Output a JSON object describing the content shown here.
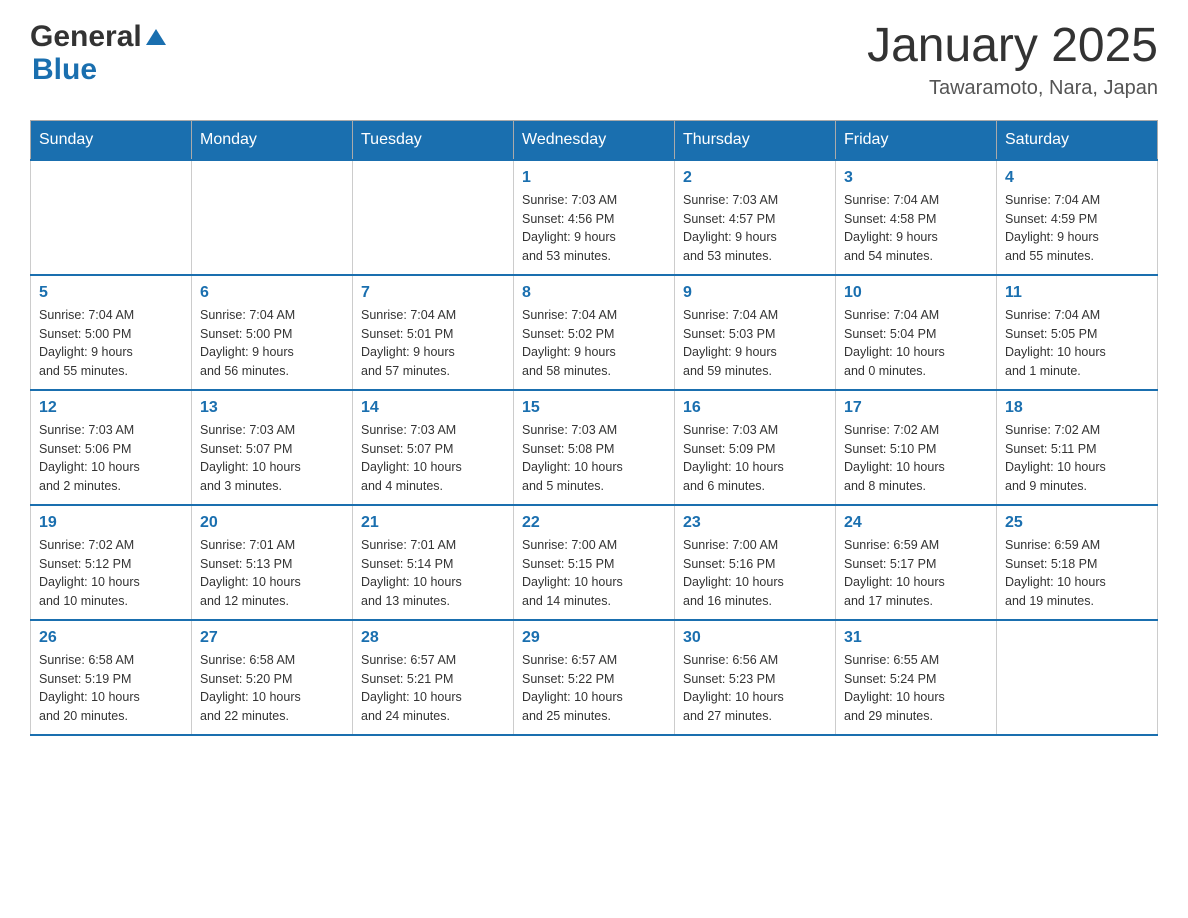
{
  "header": {
    "logo_general": "General",
    "logo_blue": "Blue",
    "month_title": "January 2025",
    "location": "Tawaramoto, Nara, Japan"
  },
  "days_of_week": [
    "Sunday",
    "Monday",
    "Tuesday",
    "Wednesday",
    "Thursday",
    "Friday",
    "Saturday"
  ],
  "weeks": [
    [
      {
        "day": "",
        "info": ""
      },
      {
        "day": "",
        "info": ""
      },
      {
        "day": "",
        "info": ""
      },
      {
        "day": "1",
        "info": "Sunrise: 7:03 AM\nSunset: 4:56 PM\nDaylight: 9 hours\nand 53 minutes."
      },
      {
        "day": "2",
        "info": "Sunrise: 7:03 AM\nSunset: 4:57 PM\nDaylight: 9 hours\nand 53 minutes."
      },
      {
        "day": "3",
        "info": "Sunrise: 7:04 AM\nSunset: 4:58 PM\nDaylight: 9 hours\nand 54 minutes."
      },
      {
        "day": "4",
        "info": "Sunrise: 7:04 AM\nSunset: 4:59 PM\nDaylight: 9 hours\nand 55 minutes."
      }
    ],
    [
      {
        "day": "5",
        "info": "Sunrise: 7:04 AM\nSunset: 5:00 PM\nDaylight: 9 hours\nand 55 minutes."
      },
      {
        "day": "6",
        "info": "Sunrise: 7:04 AM\nSunset: 5:00 PM\nDaylight: 9 hours\nand 56 minutes."
      },
      {
        "day": "7",
        "info": "Sunrise: 7:04 AM\nSunset: 5:01 PM\nDaylight: 9 hours\nand 57 minutes."
      },
      {
        "day": "8",
        "info": "Sunrise: 7:04 AM\nSunset: 5:02 PM\nDaylight: 9 hours\nand 58 minutes."
      },
      {
        "day": "9",
        "info": "Sunrise: 7:04 AM\nSunset: 5:03 PM\nDaylight: 9 hours\nand 59 minutes."
      },
      {
        "day": "10",
        "info": "Sunrise: 7:04 AM\nSunset: 5:04 PM\nDaylight: 10 hours\nand 0 minutes."
      },
      {
        "day": "11",
        "info": "Sunrise: 7:04 AM\nSunset: 5:05 PM\nDaylight: 10 hours\nand 1 minute."
      }
    ],
    [
      {
        "day": "12",
        "info": "Sunrise: 7:03 AM\nSunset: 5:06 PM\nDaylight: 10 hours\nand 2 minutes."
      },
      {
        "day": "13",
        "info": "Sunrise: 7:03 AM\nSunset: 5:07 PM\nDaylight: 10 hours\nand 3 minutes."
      },
      {
        "day": "14",
        "info": "Sunrise: 7:03 AM\nSunset: 5:07 PM\nDaylight: 10 hours\nand 4 minutes."
      },
      {
        "day": "15",
        "info": "Sunrise: 7:03 AM\nSunset: 5:08 PM\nDaylight: 10 hours\nand 5 minutes."
      },
      {
        "day": "16",
        "info": "Sunrise: 7:03 AM\nSunset: 5:09 PM\nDaylight: 10 hours\nand 6 minutes."
      },
      {
        "day": "17",
        "info": "Sunrise: 7:02 AM\nSunset: 5:10 PM\nDaylight: 10 hours\nand 8 minutes."
      },
      {
        "day": "18",
        "info": "Sunrise: 7:02 AM\nSunset: 5:11 PM\nDaylight: 10 hours\nand 9 minutes."
      }
    ],
    [
      {
        "day": "19",
        "info": "Sunrise: 7:02 AM\nSunset: 5:12 PM\nDaylight: 10 hours\nand 10 minutes."
      },
      {
        "day": "20",
        "info": "Sunrise: 7:01 AM\nSunset: 5:13 PM\nDaylight: 10 hours\nand 12 minutes."
      },
      {
        "day": "21",
        "info": "Sunrise: 7:01 AM\nSunset: 5:14 PM\nDaylight: 10 hours\nand 13 minutes."
      },
      {
        "day": "22",
        "info": "Sunrise: 7:00 AM\nSunset: 5:15 PM\nDaylight: 10 hours\nand 14 minutes."
      },
      {
        "day": "23",
        "info": "Sunrise: 7:00 AM\nSunset: 5:16 PM\nDaylight: 10 hours\nand 16 minutes."
      },
      {
        "day": "24",
        "info": "Sunrise: 6:59 AM\nSunset: 5:17 PM\nDaylight: 10 hours\nand 17 minutes."
      },
      {
        "day": "25",
        "info": "Sunrise: 6:59 AM\nSunset: 5:18 PM\nDaylight: 10 hours\nand 19 minutes."
      }
    ],
    [
      {
        "day": "26",
        "info": "Sunrise: 6:58 AM\nSunset: 5:19 PM\nDaylight: 10 hours\nand 20 minutes."
      },
      {
        "day": "27",
        "info": "Sunrise: 6:58 AM\nSunset: 5:20 PM\nDaylight: 10 hours\nand 22 minutes."
      },
      {
        "day": "28",
        "info": "Sunrise: 6:57 AM\nSunset: 5:21 PM\nDaylight: 10 hours\nand 24 minutes."
      },
      {
        "day": "29",
        "info": "Sunrise: 6:57 AM\nSunset: 5:22 PM\nDaylight: 10 hours\nand 25 minutes."
      },
      {
        "day": "30",
        "info": "Sunrise: 6:56 AM\nSunset: 5:23 PM\nDaylight: 10 hours\nand 27 minutes."
      },
      {
        "day": "31",
        "info": "Sunrise: 6:55 AM\nSunset: 5:24 PM\nDaylight: 10 hours\nand 29 minutes."
      },
      {
        "day": "",
        "info": ""
      }
    ]
  ]
}
